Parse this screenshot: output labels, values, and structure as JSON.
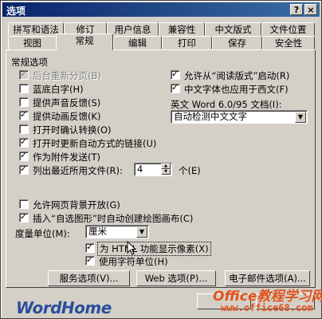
{
  "window": {
    "title": "选项",
    "help_btn": "?",
    "close_btn": "×"
  },
  "tabs_row1": [
    "拼写和语法",
    "修订",
    "用户信息",
    "兼容性",
    "中文版式",
    "文件位置"
  ],
  "tabs_row2": [
    "视图",
    "常规",
    "编辑",
    "打印",
    "保存",
    "安全性"
  ],
  "active_tab": "常规",
  "section_title": "常规选项",
  "left_options": [
    {
      "label": "后台重新分页(B)",
      "checked": true,
      "disabled": true
    },
    {
      "label": "蓝底白字(H)",
      "checked": false,
      "disabled": false
    },
    {
      "label": "提供声音反馈(S)",
      "checked": false,
      "disabled": false
    },
    {
      "label": "提供动画反馈(K)",
      "checked": true,
      "disabled": false
    },
    {
      "label": "打开时确认转换(O)",
      "checked": false,
      "disabled": false
    },
    {
      "label": "打开时更新自动方式的链接(U)",
      "checked": true,
      "disabled": false
    },
    {
      "label": "作为附件发送(T)",
      "checked": true,
      "disabled": false
    },
    {
      "label": "列出最近所用文件(R):",
      "checked": true,
      "disabled": false
    }
  ],
  "recent_files": {
    "value": "4",
    "unit": "个(E)"
  },
  "right_options": [
    {
      "label": "允许从“阅读版式”启动(R)",
      "checked": true
    },
    {
      "label": "中文字体也应用于西文(F)",
      "checked": true
    }
  ],
  "doc_label": "英文 Word 6.0/95 文档(I):",
  "doc_select": "自动检测中文文字",
  "lower_options": [
    {
      "label": "允许网页背景开放(G)",
      "checked": false
    },
    {
      "label": "插入“自选图形”时自动创建绘图画布(C)",
      "checked": true
    }
  ],
  "measure_label": "度量单位(M):",
  "measure_value": "厘米",
  "html_option": {
    "label": "为 HTML 功能显示像素(X)",
    "checked": true
  },
  "char_unit_option": {
    "label": "使用字符单位(H)",
    "checked": true
  },
  "buttons": {
    "service": "服务选项(V)...",
    "web": "Web 选项(P)...",
    "email": "电子邮件选项(A)..."
  },
  "watermark_left": "WordHome",
  "watermark_right": {
    "line1": "Office教程学习网",
    "line2": "www.office68.com"
  }
}
